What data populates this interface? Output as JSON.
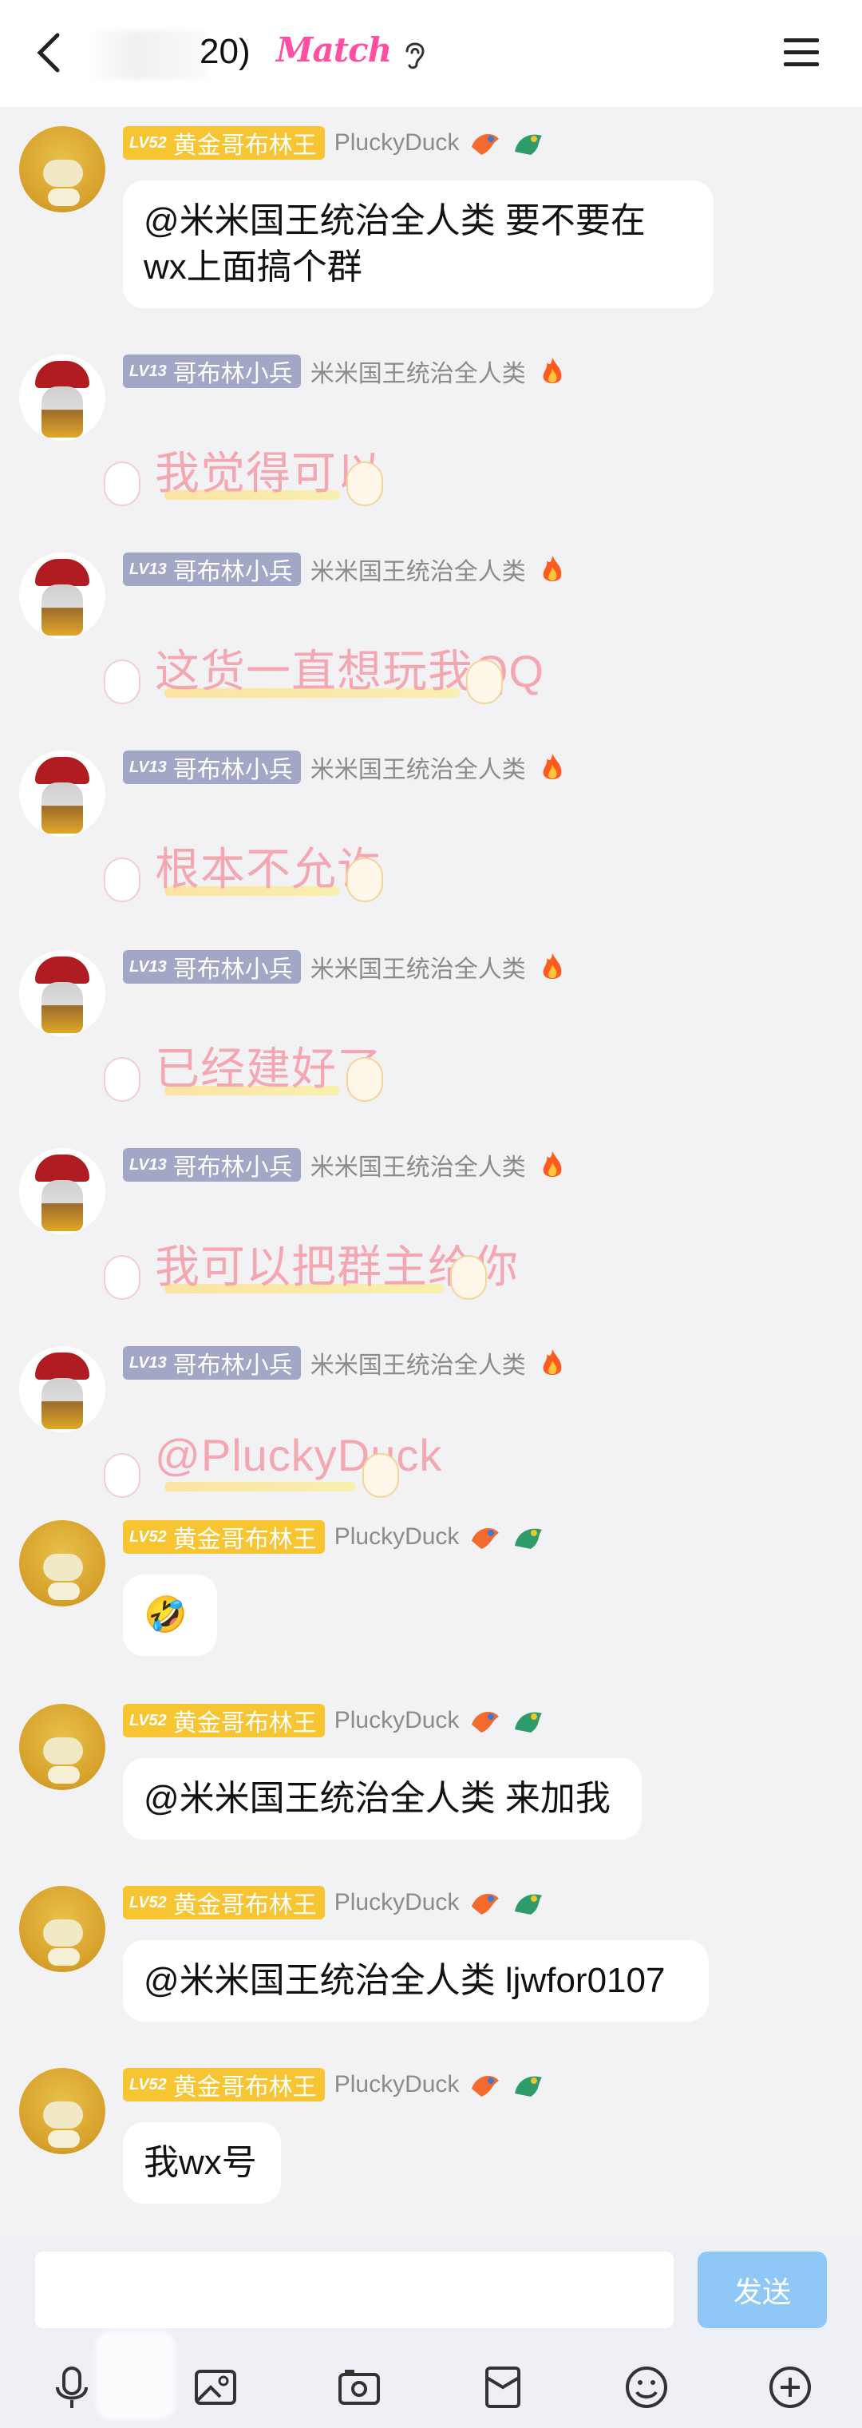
{
  "header": {
    "title_count": "20)",
    "title_badge": "Match"
  },
  "messages": [
    {
      "type": "text",
      "level": "LV52",
      "rank": "黄金哥布林王",
      "nick": "PluckyDuck",
      "avatar": "duck",
      "text_lines": [
        "@米米国王统治全人类 要不要在",
        "wx上面搞个群"
      ]
    },
    {
      "type": "sticker",
      "level": "LV13",
      "rank": "哥布林小兵",
      "nick": "米米国王统治全人类",
      "avatar": "emperor",
      "sticker_text": "我觉得可以"
    },
    {
      "type": "sticker",
      "level": "LV13",
      "rank": "哥布林小兵",
      "nick": "米米国王统治全人类",
      "avatar": "emperor",
      "sticker_text": "这货一直想玩我QQ"
    },
    {
      "type": "sticker",
      "level": "LV13",
      "rank": "哥布林小兵",
      "nick": "米米国王统治全人类",
      "avatar": "emperor",
      "sticker_text": "根本不允许"
    },
    {
      "type": "sticker",
      "level": "LV13",
      "rank": "哥布林小兵",
      "nick": "米米国王统治全人类",
      "avatar": "emperor",
      "sticker_text": "已经建好了"
    },
    {
      "type": "sticker",
      "level": "LV13",
      "rank": "哥布林小兵",
      "nick": "米米国王统治全人类",
      "avatar": "emperor",
      "sticker_text": "我可以把群主给你"
    },
    {
      "type": "sticker",
      "level": "LV13",
      "rank": "哥布林小兵",
      "nick": "米米国王统治全人类",
      "avatar": "emperor",
      "sticker_text": "@PluckyDuck"
    },
    {
      "type": "text",
      "level": "LV52",
      "rank": "黄金哥布林王",
      "nick": "PluckyDuck",
      "avatar": "duck",
      "text_lines": [
        "🤣"
      ]
    },
    {
      "type": "text",
      "level": "LV52",
      "rank": "黄金哥布林王",
      "nick": "PluckyDuck",
      "avatar": "duck",
      "text_lines": [
        "@米米国王统治全人类 来加我"
      ]
    },
    {
      "type": "text",
      "level": "LV52",
      "rank": "黄金哥布林王",
      "nick": "PluckyDuck",
      "avatar": "duck",
      "text_lines": [
        "@米米国王统治全人类 ljwfor0107"
      ]
    },
    {
      "type": "text",
      "level": "LV52",
      "rank": "黄金哥布林王",
      "nick": "PluckyDuck",
      "avatar": "duck",
      "text_lines": [
        "我wx号"
      ]
    }
  ],
  "composer": {
    "send_label": "发送"
  },
  "toolbar": {
    "icons": [
      "microphone-icon",
      "image-icon",
      "camera-icon",
      "red-packet-icon",
      "emoji-icon",
      "plus-icon"
    ]
  },
  "colors": {
    "accent": "#ff4fa3",
    "gold_badge": "#f7c531",
    "gray_badge": "#a2a7c6",
    "send_button": "#8fc8f7"
  }
}
